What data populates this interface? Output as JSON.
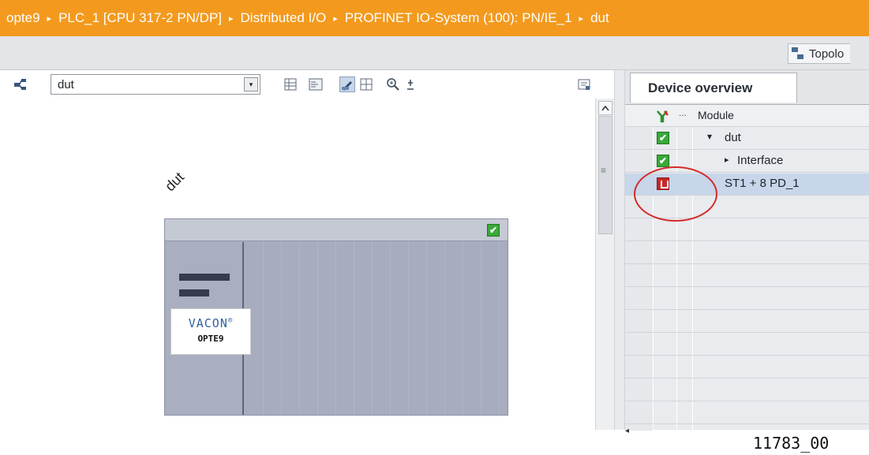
{
  "breadcrumb": {
    "items": [
      "opte9",
      "PLC_1 [CPU 317-2 PN/DP]",
      "Distributed I/O",
      "PROFINET IO-System (100): PN/IE_1",
      "dut"
    ],
    "separator": "▸"
  },
  "view_tabs": {
    "topology_label": "Topolo"
  },
  "editor_toolbar": {
    "device_select_value": "dut",
    "dropdown_glyph": "▾"
  },
  "device": {
    "name": "dut",
    "logo_text": "VACON",
    "logo_mark": "®",
    "model": "OPTE9",
    "status_check": "✔"
  },
  "device_overview": {
    "tab_label": "Device overview",
    "column_header": "Module",
    "header_dots": "...",
    "rows": [
      {
        "status": "ok",
        "check": "✔",
        "expander": "▾",
        "label": "dut"
      },
      {
        "status": "ok",
        "check": "✔",
        "expander": "▸",
        "label": "Interface"
      },
      {
        "status": "error",
        "label": "ST1 + 8 PD_1"
      }
    ]
  },
  "colors": {
    "breadcrumb_bg": "#f39a1e",
    "device_body": "#a7adbf",
    "status_ok": "#3aa83a",
    "status_error": "#c62828",
    "highlight_ring": "#d42a2a",
    "selected_row": "#c7d6ea"
  },
  "icons": [
    "topology-icon",
    "network-icon",
    "dropdown-icon",
    "zoom-in-icon",
    "grid-icon",
    "ok-status-icon",
    "error-status-icon",
    "diagnostic-icon"
  ],
  "figure_code": "11783_00"
}
